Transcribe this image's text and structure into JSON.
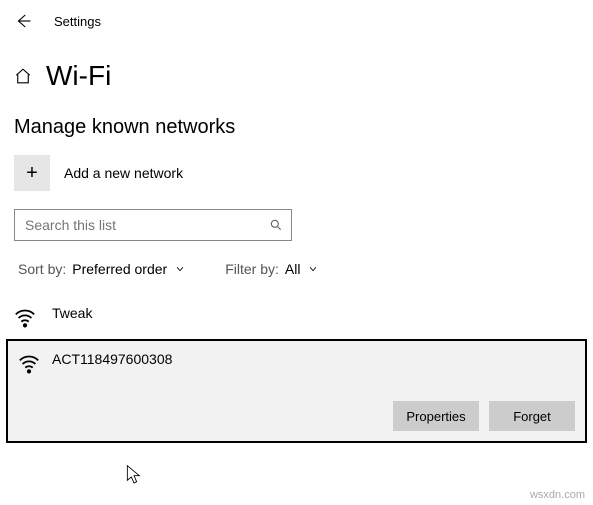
{
  "topbar": {
    "settings_label": "Settings"
  },
  "header": {
    "title": "Wi-Fi"
  },
  "section": {
    "title": "Manage known networks"
  },
  "add": {
    "label": "Add a new network",
    "plus": "+"
  },
  "search": {
    "placeholder": "Search this list"
  },
  "filters": {
    "sort_label": "Sort by:",
    "sort_value": "Preferred order",
    "filter_label": "Filter by:",
    "filter_value": "All"
  },
  "networks": {
    "item0": {
      "name": "Tweak"
    },
    "item1": {
      "name": "ACT118497600308"
    }
  },
  "buttons": {
    "properties": "Properties",
    "forget": "Forget"
  },
  "watermark": "wsxdn.com"
}
